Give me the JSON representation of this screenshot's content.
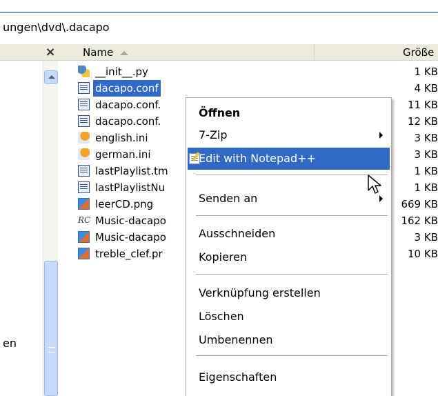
{
  "address": {
    "path": "ungen\\dvd\\.dacapo"
  },
  "left_pane": {
    "close_glyph": "×",
    "partial_label": "en"
  },
  "file_list": {
    "columns": {
      "name": "Name",
      "size": "Größe"
    },
    "rows": [
      {
        "name": "__init__.py",
        "size": "1 KB",
        "icon": "python-file-icon"
      },
      {
        "name": "dacapo.conf",
        "size": "4 KB",
        "icon": "config-file-icon",
        "selected": true
      },
      {
        "name": "dacapo.conf.",
        "size": "11 KB",
        "icon": "config-file-icon"
      },
      {
        "name": "dacapo.conf.",
        "size": "12 KB",
        "icon": "config-file-icon"
      },
      {
        "name": "english.ini",
        "size": "3 KB",
        "icon": "ini-file-icon"
      },
      {
        "name": "german.ini",
        "size": "3 KB",
        "icon": "ini-file-icon"
      },
      {
        "name": "lastPlaylist.tm",
        "size": "1 KB",
        "icon": "config-file-icon"
      },
      {
        "name": "lastPlaylistNu",
        "size": "1 KB",
        "icon": "config-file-icon"
      },
      {
        "name": "leerCD.png",
        "size": "669 KB",
        "icon": "png-file-icon"
      },
      {
        "name": "Music-dacapo",
        "size": "162 KB",
        "icon": "rc-file-icon",
        "icon_text": "RC"
      },
      {
        "name": "Music-dacapo",
        "size": "3 KB",
        "icon": "png-file-icon"
      },
      {
        "name": "treble_clef.pr",
        "size": "10 KB",
        "icon": "png-file-icon"
      }
    ]
  },
  "context_menu": {
    "open": "Öffnen",
    "zip": "7-Zip",
    "edit_notepad": "Edit with Notepad++",
    "send_to": "Senden an",
    "cut": "Ausschneiden",
    "copy": "Kopieren",
    "create_shortcut": "Verknüpfung erstellen",
    "delete": "Löschen",
    "rename": "Umbenennen",
    "properties": "Eigenschaften"
  },
  "colors": {
    "selection": "#316ac5",
    "header": "#ebeadb",
    "scrollbar": "#c8d9f9"
  }
}
